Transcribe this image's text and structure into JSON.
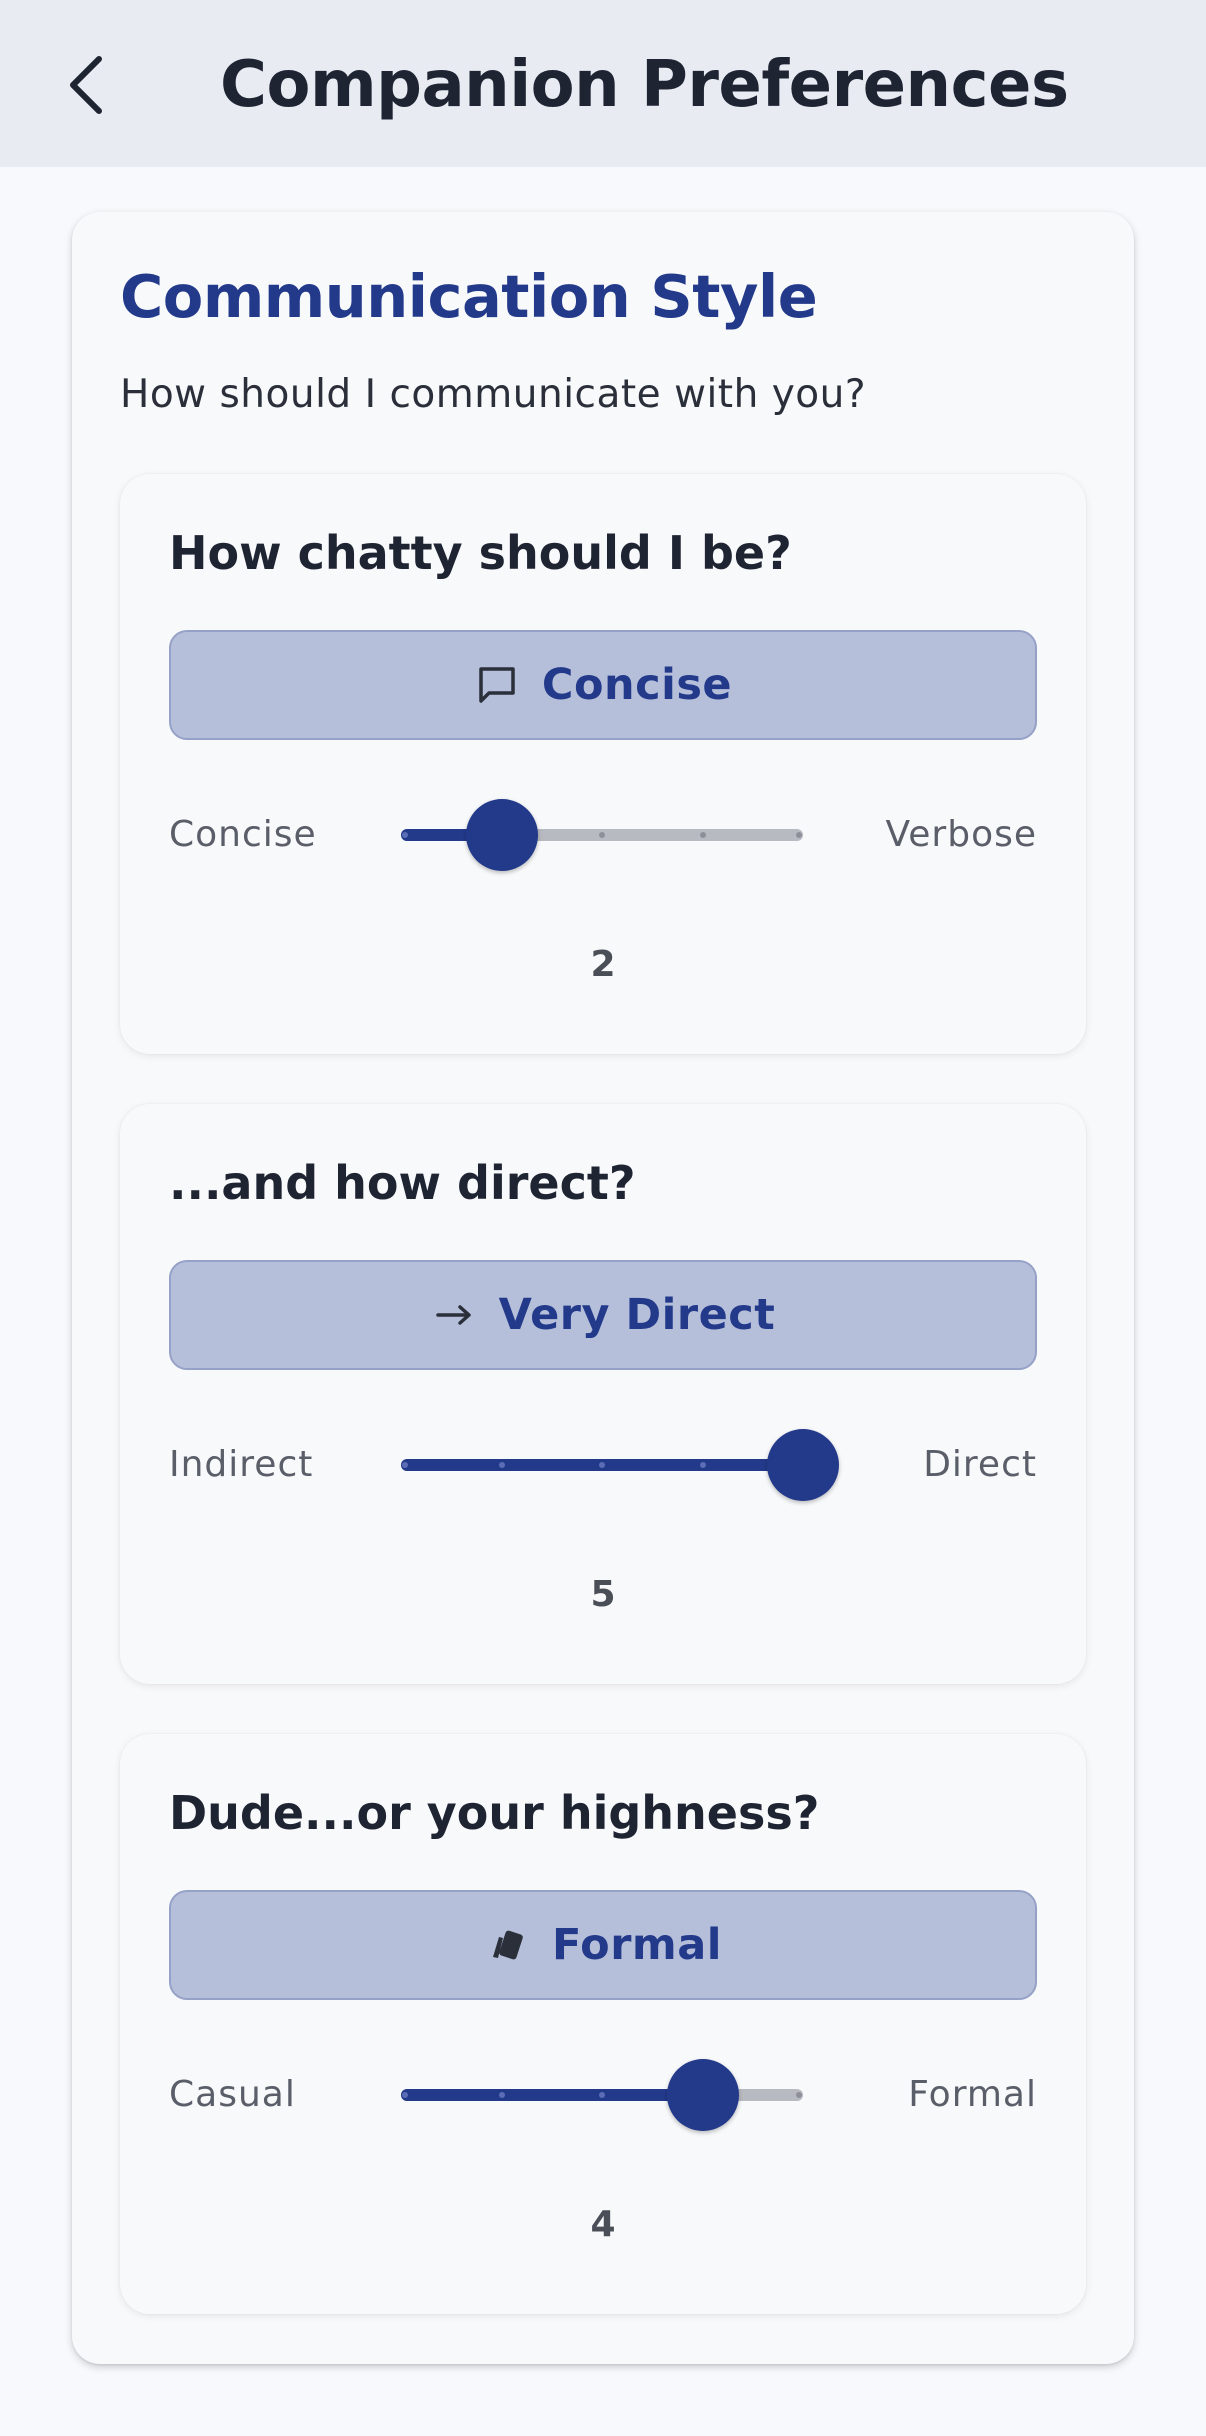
{
  "header": {
    "title": "Companion Preferences",
    "back_icon": "chevron-left-icon"
  },
  "section": {
    "title": "Communication Style",
    "subtitle": "How should I communicate with you?"
  },
  "preferences": [
    {
      "question": "How chatty should I be?",
      "chip_label": "Concise",
      "chip_icon": "speech-bubble-icon",
      "min_label": "Concise",
      "max_label": "Verbose",
      "value": 2,
      "min": 1,
      "max": 5,
      "value_text": "2"
    },
    {
      "question": "...and how direct?",
      "chip_label": "Very Direct",
      "chip_icon": "arrow-right-icon",
      "min_label": "Indirect",
      "max_label": "Direct",
      "value": 5,
      "min": 1,
      "max": 5,
      "value_text": "5"
    },
    {
      "question": "Dude...or your highness?",
      "chip_label": "Formal",
      "chip_icon": "cards-icon",
      "min_label": "Casual",
      "max_label": "Formal",
      "value": 4,
      "min": 1,
      "max": 5,
      "value_text": "4"
    }
  ],
  "colors": {
    "accent": "#233a8b",
    "chip_background": "#b6bfda",
    "track_inactive": "#b8bac1",
    "header_background": "#e8ebf2",
    "page_background": "#f7f9fc"
  }
}
